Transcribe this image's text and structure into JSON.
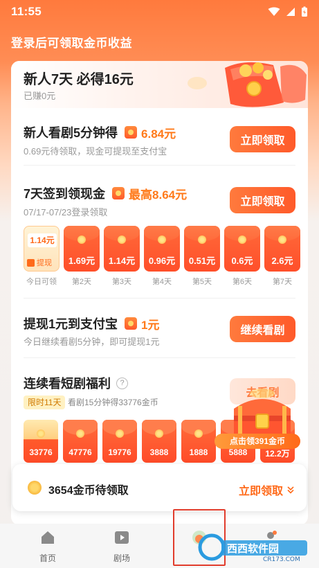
{
  "status": {
    "time": "11:55"
  },
  "header": {
    "login_prompt": "登录后可领取金币收益"
  },
  "newbie": {
    "title": "新人7天 必得16元",
    "earned": "已赚0元"
  },
  "tasks": {
    "watch5": {
      "title": "新人看剧5分钟得",
      "reward": "6.84元",
      "sub": "0.69元待领取，现金可提现至支付宝",
      "button": "立即领取"
    },
    "checkin": {
      "title": "7天签到领现金",
      "reward": "最高8.64元",
      "sub": "07/17-07/23登录领取",
      "button": "立即领取",
      "today": {
        "amount": "1.14元",
        "withdraw": "提现",
        "label": "今日可领"
      },
      "days": [
        {
          "amount": "1.69元",
          "label": "第2天"
        },
        {
          "amount": "1.14元",
          "label": "第3天"
        },
        {
          "amount": "0.96元",
          "label": "第4天"
        },
        {
          "amount": "0.51元",
          "label": "第5天"
        },
        {
          "amount": "0.6元",
          "label": "第6天"
        },
        {
          "amount": "2.6元",
          "label": "第7天"
        }
      ]
    },
    "withdraw": {
      "title": "提现1元到支付宝",
      "reward": "1元",
      "sub": "今日继续看剧5分钟，即可提现1元",
      "button": "继续看剧"
    },
    "drama": {
      "title": "连续看短剧福利",
      "help": "?",
      "limit": "限时11天",
      "desc": "看剧15分钟得33776金币",
      "button": "去看剧",
      "packets": [
        "33776",
        "47776",
        "19776",
        "3888",
        "1888",
        "5888",
        "12.2万"
      ],
      "chest_label": "点击领391金币"
    }
  },
  "coin_bar": {
    "text": "3654金币待领取",
    "claim": "立即领取"
  },
  "nav": [
    {
      "label": "首页",
      "icon": "home-icon"
    },
    {
      "label": "剧场",
      "icon": "play-icon"
    },
    {
      "label": "",
      "icon": "welfare-icon"
    },
    {
      "label": "",
      "icon": "profile-icon"
    }
  ],
  "watermark": {
    "brand": "西西软件园",
    "site": "CR173.COM"
  },
  "colors": {
    "accent": "#ff6a1a",
    "header": "#ff7a3d",
    "highlight": "#e13c2c"
  }
}
